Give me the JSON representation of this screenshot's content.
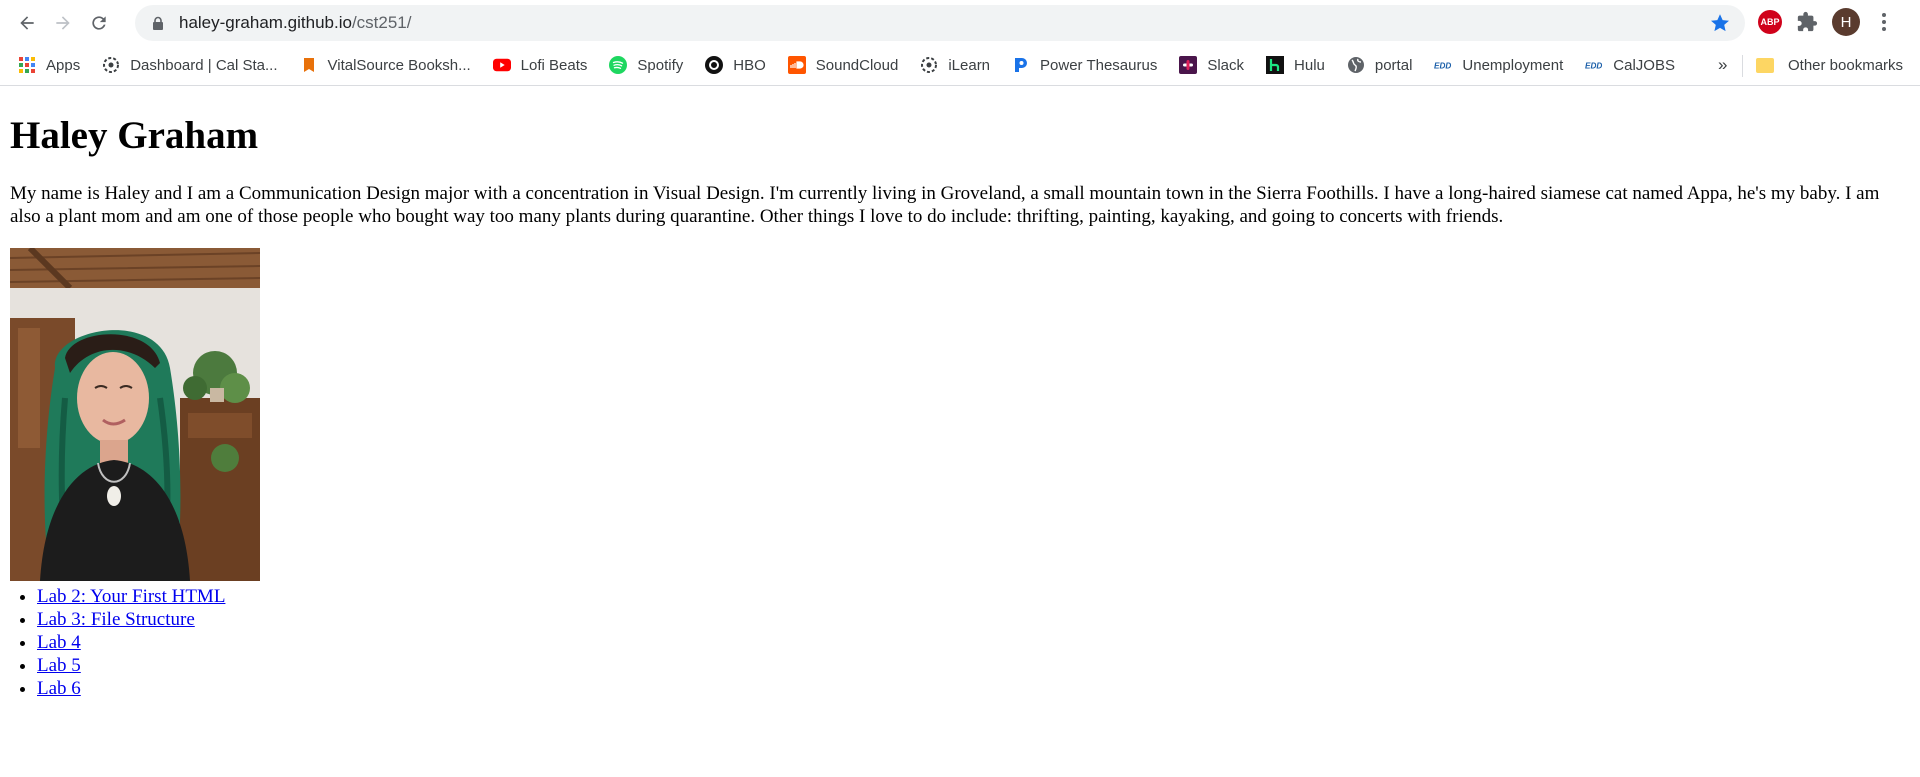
{
  "browser": {
    "url_host": "haley-graham.github.io",
    "url_path": "/cst251/",
    "profile_initial": "H",
    "adblock_label": "ABP"
  },
  "bookmarks": [
    {
      "label": "Apps",
      "icon": "apps-grid-icon"
    },
    {
      "label": "Dashboard | Cal Sta...",
      "icon": "canvas-icon"
    },
    {
      "label": "VitalSource Booksh...",
      "icon": "vitalsource-icon"
    },
    {
      "label": "Lofi Beats",
      "icon": "youtube-icon"
    },
    {
      "label": "Spotify",
      "icon": "spotify-icon"
    },
    {
      "label": "HBO",
      "icon": "hbo-icon"
    },
    {
      "label": "SoundCloud",
      "icon": "soundcloud-icon"
    },
    {
      "label": "iLearn",
      "icon": "ilearn-icon"
    },
    {
      "label": "Power Thesaurus",
      "icon": "power-thesaurus-icon"
    },
    {
      "label": "Slack",
      "icon": "slack-icon"
    },
    {
      "label": "Hulu",
      "icon": "hulu-icon"
    },
    {
      "label": "portal",
      "icon": "globe-icon"
    },
    {
      "label": "Unemployment",
      "icon": "edd-icon"
    },
    {
      "label": "CalJOBS",
      "icon": "edd-icon"
    }
  ],
  "bookmarks_overflow": "»",
  "other_bookmarks": "Other bookmarks",
  "page": {
    "title": "Haley Graham",
    "intro": "My name is Haley and I am a Communication Design major with a concentration in Visual Design. I'm currently living in Groveland, a small mountain town in the Sierra Foothills. I have a long-haired siamese cat named Appa, he's my baby. I am also a plant mom and am one of those people who bought way too many plants during quarantine. Other things I love to do include: thrifting, painting, kayaking, and going to concerts with friends.",
    "labs": [
      "Lab 2: Your First HTML",
      "Lab 3: File Structure",
      "Lab 4",
      "Lab 5",
      "Lab 6"
    ]
  },
  "colors": {
    "link": "#0000ee",
    "star": "#1a73e8",
    "omnibox_bg": "#f1f3f4"
  }
}
